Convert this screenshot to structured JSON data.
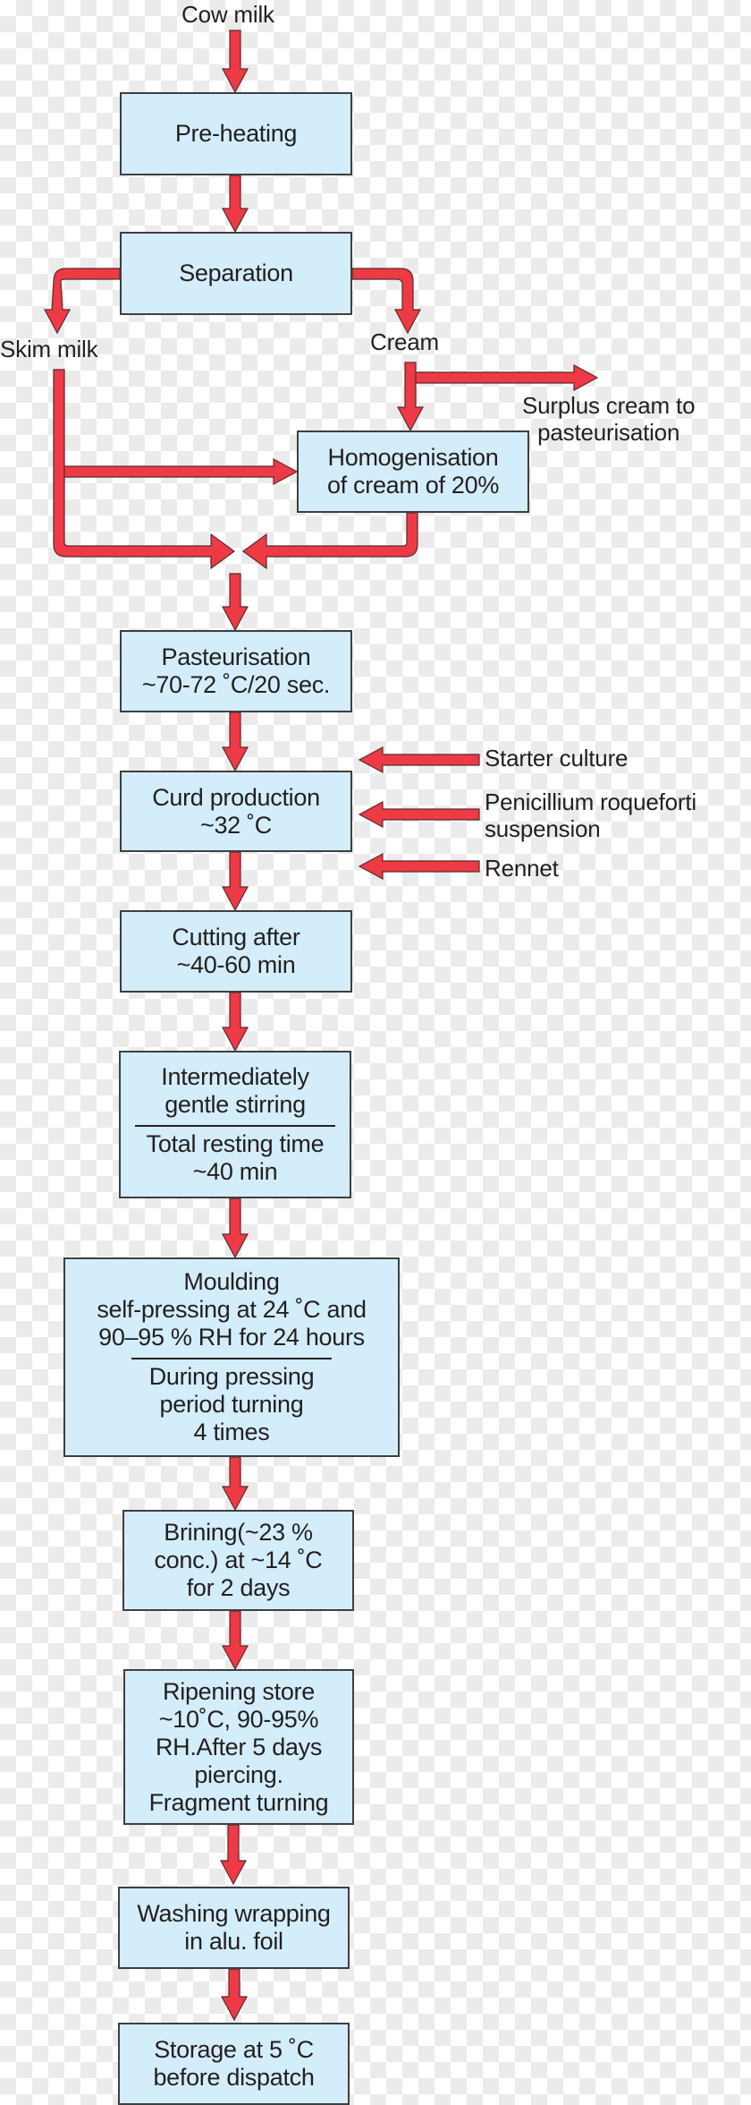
{
  "diagram": {
    "type": "process-flowchart",
    "colors": {
      "arrow_fill": "#ed3a45",
      "arrow_stroke": "#5a2a2e",
      "box_fill": "#d4edfa",
      "box_border": "#3f3f3f",
      "text": "#231f20"
    },
    "labels": {
      "input": "Cow milk",
      "skim_milk": "Skim milk",
      "cream": "Cream",
      "surplus_cream": [
        "Surplus cream to",
        "pasteurisation"
      ],
      "starter_culture": "Starter culture",
      "penicillium": [
        "Penicillium roqueforti",
        "suspension"
      ],
      "rennet": "Rennet"
    },
    "steps": {
      "preheating": [
        "Pre-heating"
      ],
      "separation": [
        "Separation"
      ],
      "homogenisation": [
        "Homogenisation",
        "of cream of 20%"
      ],
      "pasteurisation": [
        "Pasteurisation",
        "~70-72 ˚C/20 sec."
      ],
      "curd_production": [
        "Curd production",
        "~32 ˚C"
      ],
      "cutting": [
        "Cutting after",
        "~40-60 min"
      ],
      "stirring": {
        "top": [
          "Intermediately",
          "gentle stirring"
        ],
        "bottom": [
          "Total resting time",
          "~40 min"
        ]
      },
      "moulding": {
        "top": [
          "Moulding",
          "self-pressing at 24 ˚C and",
          "90–95 % RH for 24 hours"
        ],
        "bottom": [
          "During pressing",
          "period turning",
          "4 times"
        ]
      },
      "brining": [
        "Brining(~23 %",
        "conc.) at ~14 ˚C",
        "for 2 days"
      ],
      "ripening": [
        "Ripening store",
        "~10˚C, 90-95%",
        "RH.After 5 days",
        "piercing.",
        "Fragment turning"
      ],
      "washing": [
        "Washing wrapping",
        "in alu. foil"
      ],
      "storage": [
        "Storage at 5 ˚C",
        "before dispatch"
      ]
    }
  }
}
